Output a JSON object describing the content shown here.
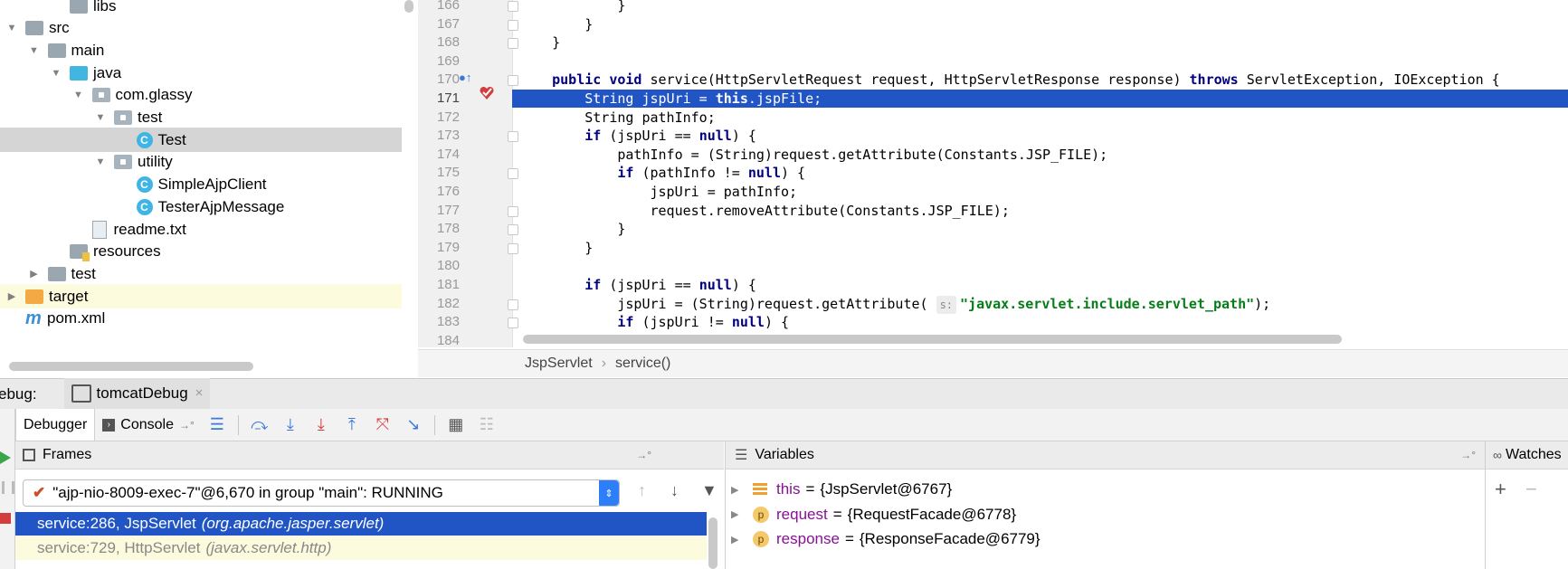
{
  "project_tree": [
    {
      "label": "libs",
      "depth": 2,
      "icon": "folder-icon",
      "state": "none"
    },
    {
      "label": "src",
      "depth": 0,
      "icon": "folder-icon",
      "state": "expanded"
    },
    {
      "label": "main",
      "depth": 1,
      "icon": "folder-icon",
      "state": "expanded"
    },
    {
      "label": "java",
      "depth": 2,
      "icon": "source-folder-icon",
      "state": "expanded"
    },
    {
      "label": "com.glassy",
      "depth": 3,
      "icon": "package-icon",
      "state": "expanded"
    },
    {
      "label": "test",
      "depth": 4,
      "icon": "package-icon",
      "state": "expanded"
    },
    {
      "label": "Test",
      "depth": 5,
      "icon": "class-icon",
      "state": "none",
      "selected": true
    },
    {
      "label": "utility",
      "depth": 4,
      "icon": "package-icon",
      "state": "expanded"
    },
    {
      "label": "SimpleAjpClient",
      "depth": 5,
      "icon": "class-icon",
      "state": "none"
    },
    {
      "label": "TesterAjpMessage",
      "depth": 5,
      "icon": "class-icon",
      "state": "none"
    },
    {
      "label": "readme.txt",
      "depth": 3,
      "icon": "text-file-icon",
      "state": "none"
    },
    {
      "label": "resources",
      "depth": 2,
      "icon": "resources-folder-icon",
      "state": "none"
    },
    {
      "label": "test",
      "depth": 1,
      "icon": "folder-icon",
      "state": "collapsed"
    },
    {
      "label": "target",
      "depth": 0,
      "icon": "excluded-folder-icon",
      "state": "collapsed",
      "highlight": true
    },
    {
      "label": "pom.xml",
      "depth": 0,
      "icon": "maven-icon",
      "state": "none"
    }
  ],
  "class_icon_letter": "C",
  "maven_icon_letter": "m",
  "editor": {
    "current_line": 171,
    "lines": [
      {
        "n": "166",
        "html": "            }"
      },
      {
        "n": "167",
        "html": "        }"
      },
      {
        "n": "168",
        "html": "    }"
      },
      {
        "n": "169",
        "html": ""
      },
      {
        "n": "170",
        "html": "    <span class=\"kw\">public void</span> service(HttpServletRequest request, HttpServletResponse response) <span class=\"kw\">throws</span> ServletException, IOException {"
      },
      {
        "n": "171",
        "html": "        String jspUri = <span class=\"kw\">this</span>.jspFile;"
      },
      {
        "n": "172",
        "html": "        String pathInfo;"
      },
      {
        "n": "173",
        "html": "        <span class=\"kw\">if</span> (jspUri == <span class=\"kw\">null</span>) {"
      },
      {
        "n": "174",
        "html": "            pathInfo = (String)request.getAttribute(Constants.JSP_FILE);"
      },
      {
        "n": "175",
        "html": "            <span class=\"kw\">if</span> (pathInfo != <span class=\"kw\">null</span>) {"
      },
      {
        "n": "176",
        "html": "                jspUri = pathInfo;"
      },
      {
        "n": "177",
        "html": "                request.removeAttribute(Constants.JSP_FILE);"
      },
      {
        "n": "178",
        "html": "            }"
      },
      {
        "n": "179",
        "html": "        }"
      },
      {
        "n": "180",
        "html": ""
      },
      {
        "n": "181",
        "html": "        <span class=\"kw\">if</span> (jspUri == <span class=\"kw\">null</span>) {"
      },
      {
        "n": "182",
        "html": "            jspUri = (String)request.getAttribute( <span class=\"hint\">s:</span><span class=\"str\">\"javax.servlet.include.servlet_path\"</span>);"
      },
      {
        "n": "183",
        "html": "            <span class=\"kw\">if</span> (jspUri != <span class=\"kw\">null</span>) {"
      },
      {
        "n": "184",
        "html": ""
      }
    ]
  },
  "breadcrumb": {
    "class": "JspServlet",
    "separator": "›",
    "method": "service()"
  },
  "debug": {
    "label": "ebug:",
    "session_tab": "tomcatDebug",
    "close_glyph": "×",
    "tabs": {
      "debugger": "Debugger",
      "console": "Console"
    },
    "frames_title": "Frames",
    "thread": "\"ajp-nio-8009-exec-7\"@6,670 in group \"main\": RUNNING",
    "frames": [
      {
        "method": "service:286, JspServlet",
        "pkg": "(org.apache.jasper.servlet)",
        "selected": true
      },
      {
        "method": "service:729, HttpServlet",
        "pkg": "(javax.servlet.http)",
        "selected": false
      }
    ],
    "variables_title": "Variables",
    "variables": [
      {
        "name": "this",
        "value": "{JspServlet@6767}",
        "icon": "field-icon"
      },
      {
        "name": "request",
        "value": "{RequestFacade@6778}",
        "icon": "parameter-icon"
      },
      {
        "name": "response",
        "value": "{ResponseFacade@6779}",
        "icon": "parameter-icon"
      }
    ],
    "param_icon_letter": "p",
    "watches_title": "Watches"
  }
}
